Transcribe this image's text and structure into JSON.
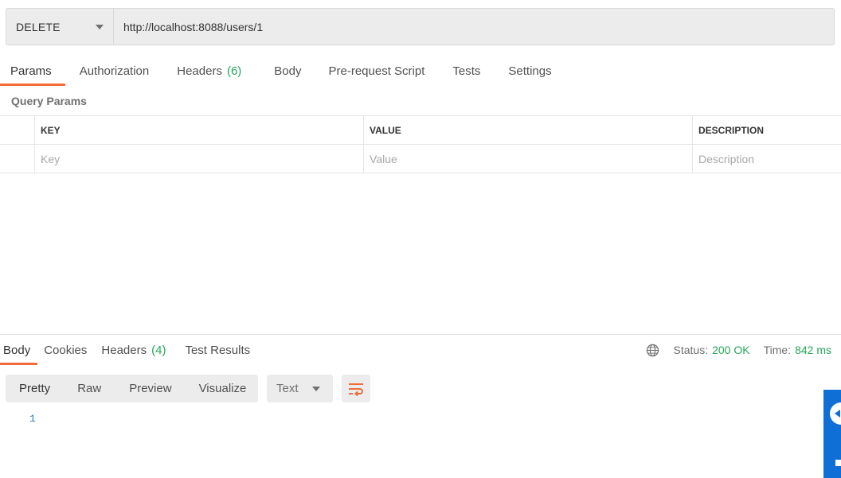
{
  "request": {
    "method": "DELETE",
    "url": "http://localhost:8088/users/1"
  },
  "request_tabs": [
    {
      "label": "Params",
      "active": true
    },
    {
      "label": "Authorization"
    },
    {
      "label": "Headers",
      "count": "(6)"
    },
    {
      "label": "Body"
    },
    {
      "label": "Pre-request Script"
    },
    {
      "label": "Tests"
    },
    {
      "label": "Settings"
    }
  ],
  "query_params": {
    "title": "Query Params",
    "headers": {
      "key": "KEY",
      "value": "VALUE",
      "description": "DESCRIPTION"
    },
    "placeholders": {
      "key": "Key",
      "value": "Value",
      "description": "Description"
    }
  },
  "response_tabs": [
    {
      "label": "Body",
      "active": true
    },
    {
      "label": "Cookies"
    },
    {
      "label": "Headers",
      "count": "(4)"
    },
    {
      "label": "Test Results"
    }
  ],
  "response_status": {
    "status_label": "Status:",
    "status_value": "200 OK",
    "time_label": "Time:",
    "time_value": "842 ms"
  },
  "format": {
    "buttons": [
      "Pretty",
      "Raw",
      "Preview",
      "Visualize"
    ],
    "active": "Pretty",
    "type": "Text"
  },
  "body_lines": [
    "1"
  ],
  "colors": {
    "accent": "#f26b3a",
    "success": "#26a65b",
    "line_number": "#2a7fb0",
    "external_widget": "#0f6fd6"
  },
  "icons": {
    "method_dropdown": "chevron-down-icon",
    "globe": "globe-icon",
    "wrap": "wrap-lines-icon",
    "type_dropdown": "chevron-down-icon"
  }
}
